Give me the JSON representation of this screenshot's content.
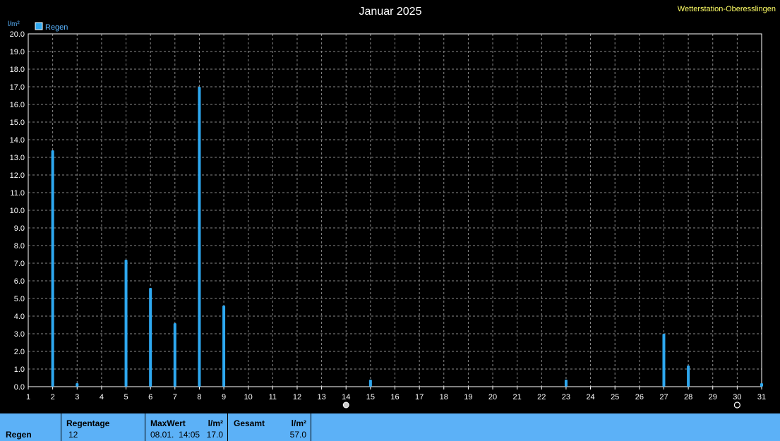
{
  "station": "Wetterstation-Oberesslingen",
  "chart_data": {
    "type": "bar",
    "title": "Januar 2025",
    "ylabel": "l/m²",
    "xlabel": "",
    "ylim": [
      0,
      20
    ],
    "y_ticks": [
      "0.0",
      "1.0",
      "2.0",
      "3.0",
      "4.0",
      "5.0",
      "6.0",
      "7.0",
      "8.0",
      "9.0",
      "10.0",
      "11.0",
      "12.0",
      "13.0",
      "14.0",
      "15.0",
      "16.0",
      "17.0",
      "18.0",
      "19.0",
      "20.0"
    ],
    "x_ticks": [
      "1",
      "2",
      "3",
      "4",
      "5",
      "6",
      "7",
      "8",
      "9",
      "10",
      "11",
      "12",
      "13",
      "14",
      "15",
      "16",
      "17",
      "18",
      "19",
      "20",
      "21",
      "22",
      "23",
      "24",
      "25",
      "26",
      "27",
      "28",
      "29",
      "30",
      "31"
    ],
    "grid": true,
    "legend_position": "top-left",
    "series": [
      {
        "name": "Regen",
        "color": "#2ea8f0",
        "points": [
          {
            "x": 2,
            "y": 13.4
          },
          {
            "x": 3,
            "y": 0.2
          },
          {
            "x": 5,
            "y": 7.2
          },
          {
            "x": 6,
            "y": 5.6
          },
          {
            "x": 7,
            "y": 3.6
          },
          {
            "x": 8,
            "y": 17.0
          },
          {
            "x": 9,
            "y": 4.6
          },
          {
            "x": 15,
            "y": 0.4
          },
          {
            "x": 23,
            "y": 0.4
          },
          {
            "x": 27,
            "y": 3.0
          },
          {
            "x": 28,
            "y": 1.2
          },
          {
            "x": 31,
            "y": 0.2
          }
        ]
      }
    ],
    "moon_phases": [
      {
        "day": 14,
        "icon": "full-moon-icon"
      },
      {
        "day": 30,
        "icon": "new-moon-icon"
      }
    ]
  },
  "summary": {
    "row_label": "Regen",
    "rain_days_label": "Regentage",
    "rain_days_value": "12",
    "max_label": "MaxWert",
    "max_unit": "l/m²",
    "max_time": "08.01.  14:05",
    "max_value": "17.0",
    "total_label": "Gesamt",
    "total_unit": "l/m²",
    "total_value": "57.0"
  }
}
